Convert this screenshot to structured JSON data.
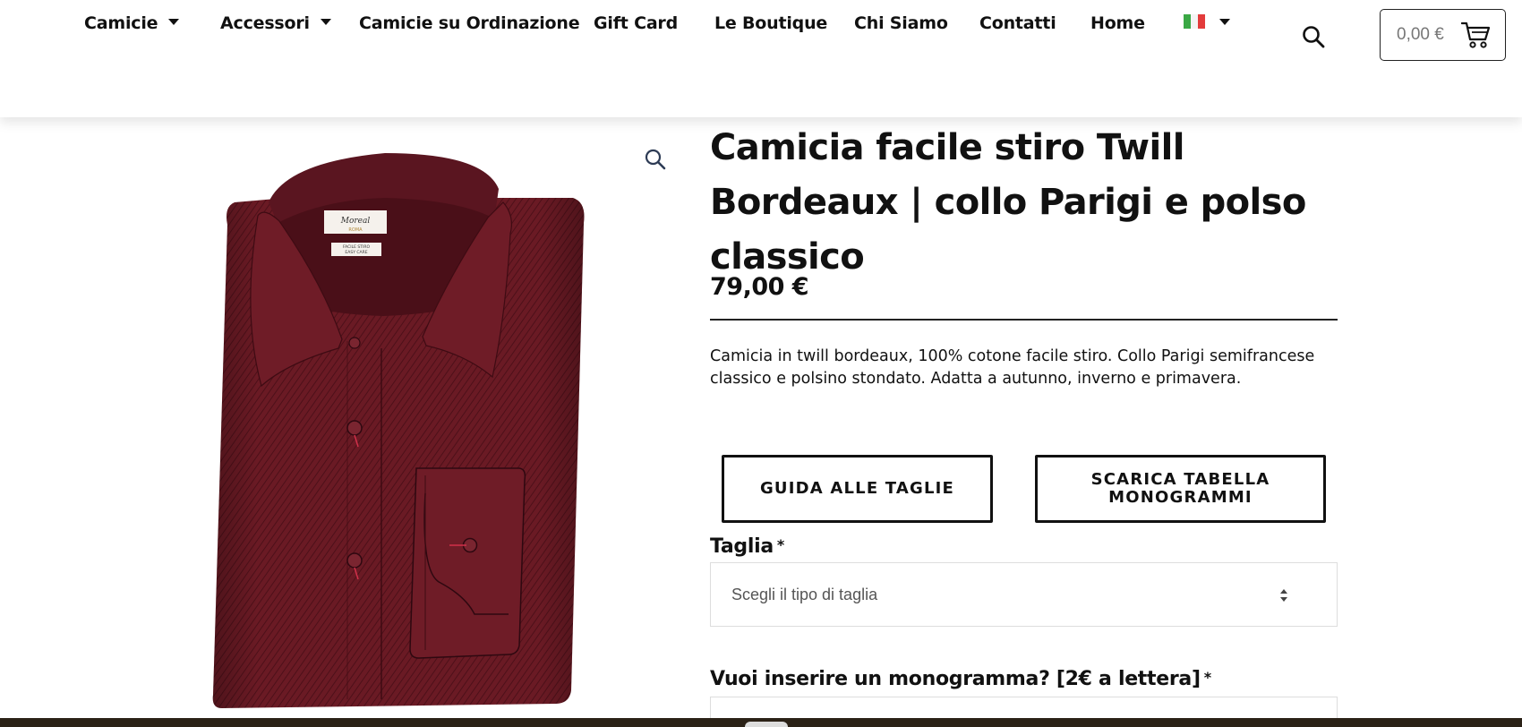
{
  "nav": {
    "items": [
      {
        "label": "Camicie",
        "has_dropdown": true
      },
      {
        "label": "Accessori",
        "has_dropdown": true
      },
      {
        "label": "Camicie su Ordinazione",
        "has_dropdown": false
      },
      {
        "label": "Gift Card",
        "has_dropdown": false
      },
      {
        "label": "Le Boutique",
        "has_dropdown": false
      },
      {
        "label": "Chi Siamo",
        "has_dropdown": false
      },
      {
        "label": "Contatti",
        "has_dropdown": false
      },
      {
        "label": "Home",
        "has_dropdown": false
      }
    ],
    "language_flag": "italy-flag-icon",
    "search_icon": "search-icon",
    "cart": {
      "total": "0,00 €",
      "icon": "cart-icon"
    }
  },
  "product": {
    "title": "Camicia facile stiro Twill Bordeaux | collo Parigi e polso classico",
    "price": "79,00 €",
    "description": "Camicia in twill bordeaux, 100% cotone facile stiro. Collo Parigi semifrancese classico e polsino stondato. Adatta a autunno, inverno e primavera.",
    "image": {
      "zoom_icon": "magnifier-zoom-icon",
      "shirt_label_brand": "Moreal",
      "shirt_label_city": "ROMA",
      "shirt_tag_1": "FACILE STIRO",
      "shirt_tag_2": "EASY CARE"
    },
    "buttons": {
      "size_guide": "GUIDA ALLE TAGLIE",
      "monogram_table": "SCARICA TABELLA MONOGRAMMI"
    },
    "size_field": {
      "label": "Taglia",
      "required_mark": "*",
      "selected": "Scegli il tipo di taglia"
    },
    "monogram_field": {
      "label": "Vuoi inserire un monogramma? [2€ a lettera]",
      "required_mark": "*"
    }
  },
  "colors": {
    "shirt": "#6a1a24",
    "text": "#111111",
    "footer": "#2b2217"
  }
}
